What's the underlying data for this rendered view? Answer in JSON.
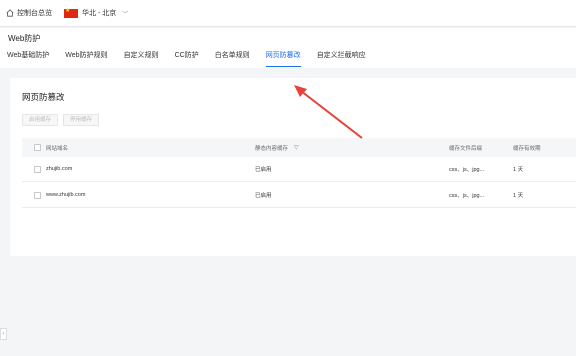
{
  "topbar": {
    "console_label": "控制台总览",
    "region_label": "华北 - 北京"
  },
  "header": {
    "title": "Web防护",
    "tabs": [
      {
        "label": "Web基础防护"
      },
      {
        "label": "Web防护规则"
      },
      {
        "label": "自定义规则"
      },
      {
        "label": "CC防护"
      },
      {
        "label": "白名单规则"
      },
      {
        "label": "网页防篡改"
      },
      {
        "label": "自定义拦截响应"
      }
    ],
    "active_tab": "网页防篡改"
  },
  "card": {
    "title": "网页防篡改",
    "enable_button": "启用缓存",
    "disable_button": "停用缓存",
    "columns": [
      "网站域名",
      "静态内容缓存",
      "缓存文件后缀",
      "缓存有效期"
    ],
    "rows": [
      {
        "domain": "zhujib.com",
        "status": "已启用",
        "suffix": "css、js、jpg...",
        "expiry": "1 天"
      },
      {
        "domain": "www.zhujib.com",
        "status": "已启用",
        "suffix": "css、js、jpg...",
        "expiry": "1 天"
      }
    ]
  },
  "colors": {
    "accent": "#1a6ef0",
    "annotation_arrow": "#e8433a"
  }
}
